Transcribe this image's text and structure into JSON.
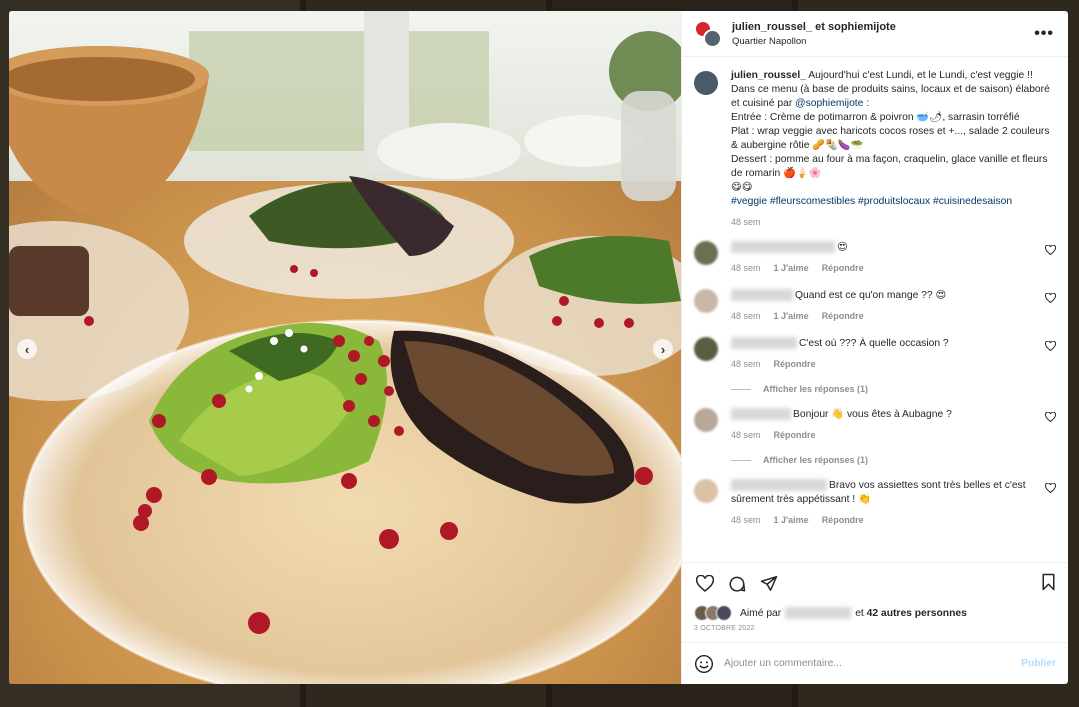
{
  "post": {
    "author": "julien_roussel_",
    "coauthor_joiner": "et",
    "coauthor": "sophiemijote",
    "location": "Quartier Napollon",
    "more_icon": "more-horizontal-icon"
  },
  "caption": {
    "user": "julien_roussel_",
    "line1": "Aujourd'hui c'est Lundi, et le Lundi, c'est veggie !!",
    "line2a": "Dans ce menu (à base de produits sains, locaux et de saison) élaboré et cuisiné par",
    "mention": "@sophiemijote",
    "line2b": ":",
    "entree": "Entrée : Crème de potimarron & poivron 🥣🌶, sarrasin torréfié",
    "plat": "Plat : wrap veggie avec haricots cocos roses et +..., salade 2 couleurs & aubergine rôtie 🥜🌯🍆🥗",
    "dessert": "Dessert : pomme au four à ma façon, craquelin, glace vanille et fleurs de romarin 🍎🍦🌸",
    "emojis": "😋😋",
    "hashtags": "#veggie #fleurscomestibles #produitslocaux #cuisinedesaison",
    "time": "48 sem"
  },
  "comments": [
    {
      "text": "😍",
      "time": "48 sem",
      "likes": "1 J'aime",
      "reply": "Répondre",
      "avatar_color": "#6b7050",
      "name_width": 104
    },
    {
      "text": "Quand est ce qu'on mange ?? 😍",
      "time": "48 sem",
      "likes": "1 J'aime",
      "reply": "Répondre",
      "avatar_color": "#c9b8a8",
      "name_width": 62
    },
    {
      "text": "C'est où ??? À quelle occasion ?",
      "time": "48 sem",
      "likes": "",
      "reply": "Répondre",
      "avatar_color": "#5a5e40",
      "name_width": 66,
      "replies": "Afficher les réponses (1)"
    },
    {
      "text": "Bonjour 👋 vous êtes à Aubagne ?",
      "time": "48 sem",
      "likes": "",
      "reply": "Répondre",
      "avatar_color": "#b8a89a",
      "name_width": 60,
      "replies": "Afficher les réponses (1)"
    },
    {
      "text": "Bravo vos assiettes sont très belles et c'est sûrement très appétissant ! 👏",
      "time": "48 sem",
      "likes": "1 J'aime",
      "reply": "Répondre",
      "avatar_color": "#d9c2a8",
      "name_width": 96
    }
  ],
  "likes": {
    "prefix": "Aimé par",
    "middle": "et",
    "others": "42 autres personnes",
    "date": "3 OCTOBRE 2022"
  },
  "composer": {
    "placeholder": "Ajouter un commentaire...",
    "publish": "Publier"
  },
  "icons": {
    "like": "heart-icon",
    "comment": "comment-icon",
    "share": "send-icon",
    "save": "bookmark-icon",
    "emoji": "smiley-icon",
    "prev": "chevron-left-icon",
    "next": "chevron-right-icon"
  },
  "colors": {
    "link": "#00376b",
    "muted": "#8e8e8e",
    "publish_disabled": "#b3dbff"
  }
}
